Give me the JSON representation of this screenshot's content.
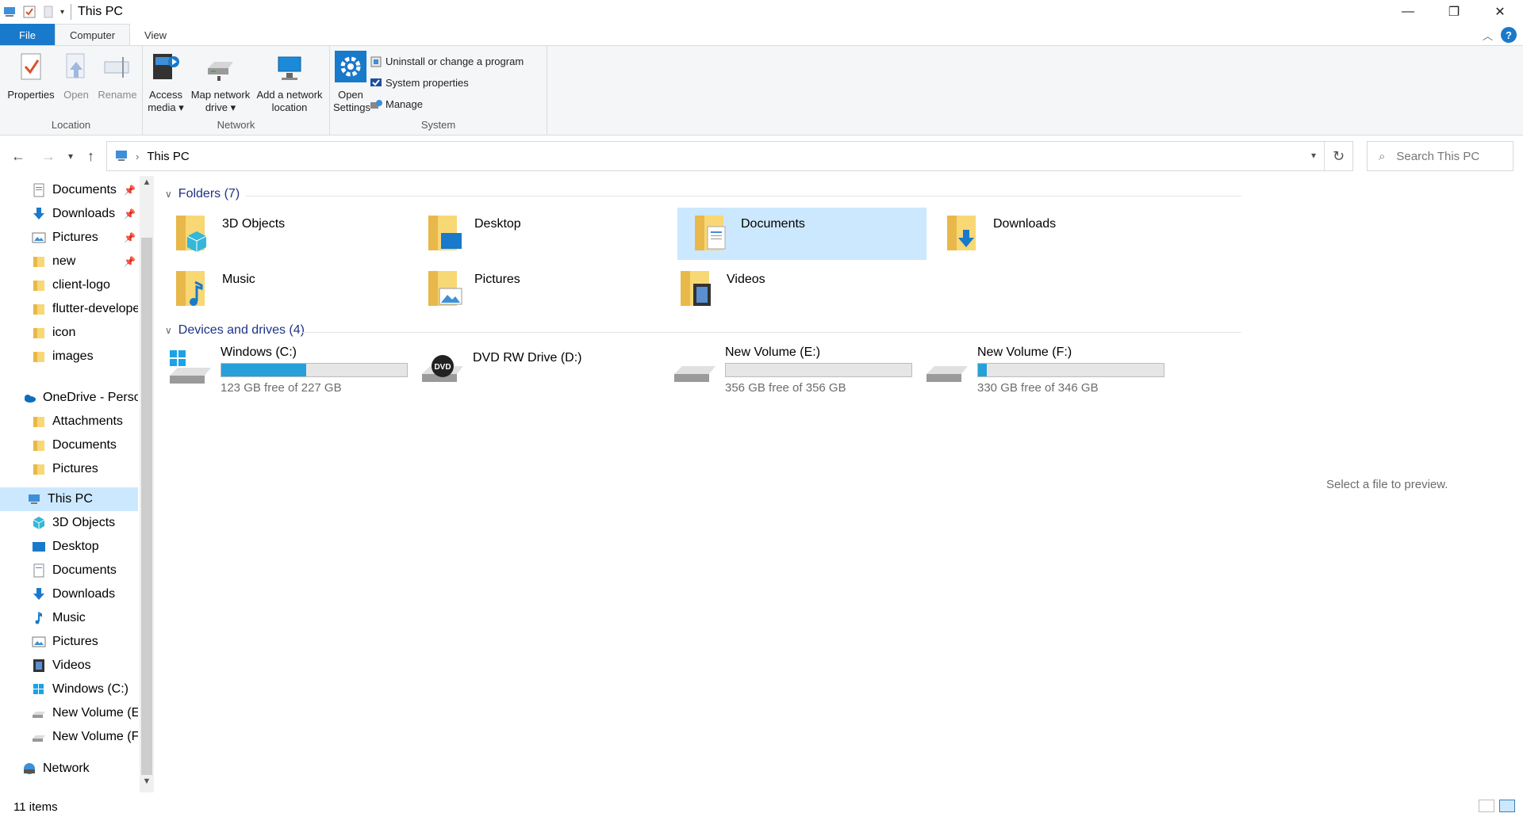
{
  "window": {
    "title": "This PC",
    "controls": [
      "—",
      "❐",
      "✕"
    ]
  },
  "ribbon_tabs": [
    "File",
    "Computer",
    "View"
  ],
  "ribbon": {
    "location": {
      "label": "Location",
      "properties": "Properties",
      "open": "Open",
      "rename": "Rename"
    },
    "network": {
      "label": "Network",
      "access_media_1": "Access",
      "access_media_2": "media ▾",
      "map_drive_1": "Map network",
      "map_drive_2": "drive ▾",
      "add_location_1": "Add a network",
      "add_location_2": "location"
    },
    "system": {
      "label": "System",
      "open_settings_1": "Open",
      "open_settings_2": "Settings",
      "uninstall": "Uninstall or change a program",
      "system_properties": "System properties",
      "manage": "Manage"
    }
  },
  "address": {
    "path": "This PC",
    "search_placeholder": "Search This PC"
  },
  "nav_pane": {
    "quick_access": [
      {
        "label": "Documents",
        "pinned": true,
        "icon": "documents-icon"
      },
      {
        "label": "Downloads",
        "pinned": true,
        "icon": "downloads-icon"
      },
      {
        "label": "Pictures",
        "pinned": true,
        "icon": "pictures-icon"
      },
      {
        "label": "new",
        "pinned": true,
        "icon": "folder-icon"
      },
      {
        "label": "client-logo",
        "pinned": false,
        "icon": "folder-icon"
      },
      {
        "label": "flutter-develope",
        "pinned": false,
        "icon": "folder-icon"
      },
      {
        "label": "icon",
        "pinned": false,
        "icon": "folder-icon"
      },
      {
        "label": "images",
        "pinned": false,
        "icon": "folder-icon"
      }
    ],
    "onedrive": {
      "label": "OneDrive - Perso",
      "children": [
        "Attachments",
        "Documents",
        "Pictures"
      ]
    },
    "this_pc": {
      "label": "This PC",
      "children": [
        "3D Objects",
        "Desktop",
        "Documents",
        "Downloads",
        "Music",
        "Pictures",
        "Videos",
        "Windows (C:)",
        "New Volume (E:",
        "New Volume (F:"
      ]
    },
    "network": "Network"
  },
  "content": {
    "folders_header": "Folders (7)",
    "folders": [
      "3D Objects",
      "Desktop",
      "Documents",
      "Downloads",
      "Music",
      "Pictures",
      "Videos"
    ],
    "devices_header": "Devices and drives (4)",
    "drives": [
      {
        "name": "Windows (C:)",
        "free": "123 GB free of 227 GB",
        "used_fraction": 0.458
      },
      {
        "name": "DVD RW Drive (D:)",
        "free": "",
        "used_fraction": null
      },
      {
        "name": "New Volume (E:)",
        "free": "356 GB free of 356 GB",
        "used_fraction": 0.0
      },
      {
        "name": "New Volume (F:)",
        "free": "330 GB free of 346 GB",
        "used_fraction": 0.046
      }
    ],
    "preview_text": "Select a file to preview."
  },
  "status": {
    "count": "11 items"
  },
  "colors": {
    "accent": "#1979ca",
    "selection": "#cce8ff",
    "drive_fill": "#26a0da",
    "folder_yellow": "#f8d775"
  }
}
